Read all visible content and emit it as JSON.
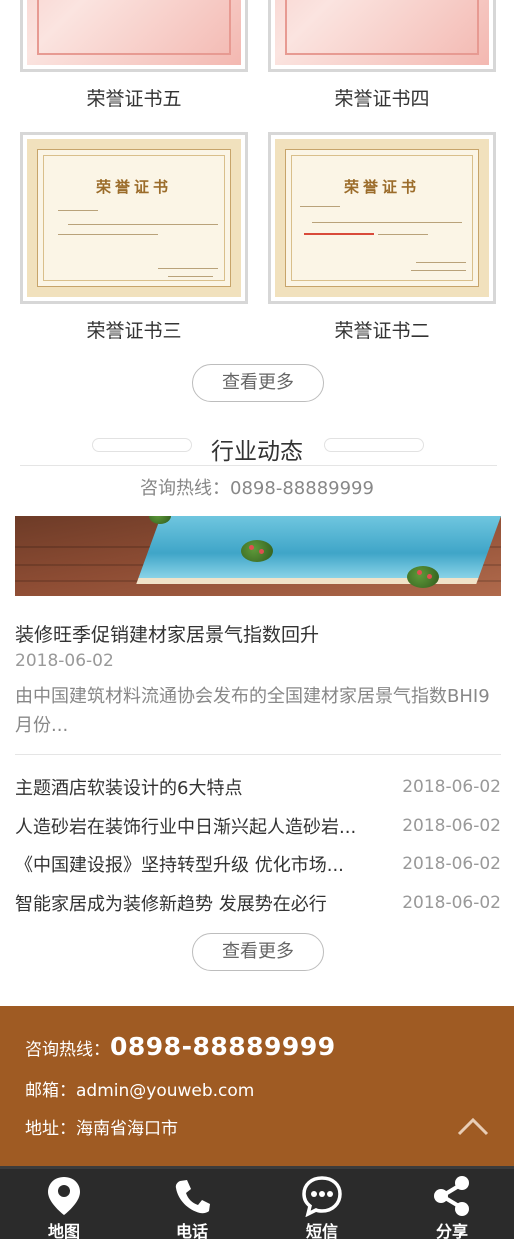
{
  "certificates": [
    {
      "label": "荣誉证书五"
    },
    {
      "label": "荣誉证书四"
    },
    {
      "label": "荣誉证书三",
      "title": "荣誉证书"
    },
    {
      "label": "荣誉证书二",
      "title": "荣誉证书"
    }
  ],
  "cert_more": "查看更多",
  "news_section": {
    "title": "行业动态",
    "hotline": "咨询热线：0898-88889999",
    "featured": {
      "title": "装修旺季促销建材家居景气指数回升",
      "date": "2018-06-02",
      "desc": "由中国建筑材料流通协会发布的全国建材家居景气指数BHI9月份..."
    },
    "list": [
      {
        "title": "主题酒店软装设计的6大特点",
        "date": "2018-06-02"
      },
      {
        "title": "人造砂岩在装饰行业中日渐兴起人造砂岩...",
        "date": "2018-06-02"
      },
      {
        "title": "《中国建设报》坚持转型升级 优化市场...",
        "date": "2018-06-02"
      },
      {
        "title": "智能家居成为装修新趋势 发展势在必行",
        "date": "2018-06-02"
      }
    ],
    "more": "查看更多"
  },
  "footer": {
    "hotline_label": "咨询热线：",
    "hotline": "0898-88889999",
    "email": "邮箱：admin@youweb.com",
    "address": "地址：海南省海口市"
  },
  "bottom_nav": [
    {
      "label": "地图",
      "icon": "map-pin-icon"
    },
    {
      "label": "电话",
      "icon": "phone-icon"
    },
    {
      "label": "短信",
      "icon": "sms-icon"
    },
    {
      "label": "分享",
      "icon": "share-icon"
    }
  ],
  "colors": {
    "footer_bg": "#9f5b23",
    "bottom_bar_bg": "#2b2b2b"
  }
}
